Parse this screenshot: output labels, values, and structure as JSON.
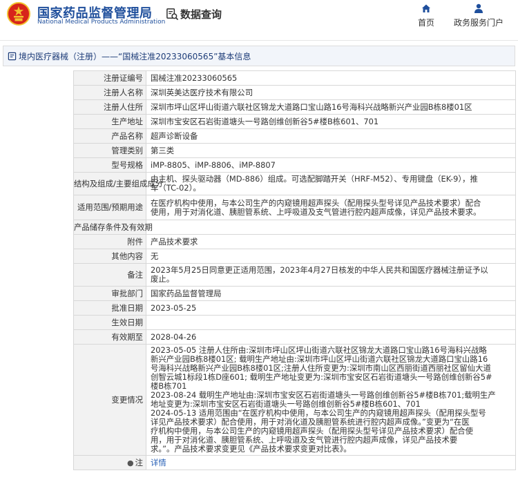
{
  "header": {
    "logo_cn": "国家药品监督管理局",
    "logo_en": "National Medical Products Administration",
    "data_query": "数据查询",
    "nav": [
      {
        "label": "首页",
        "icon": "home-icon"
      },
      {
        "label": "政务服务门户",
        "icon": "user-icon"
      }
    ]
  },
  "colors": {
    "brand_blue": "#1f4f9c",
    "link_blue": "#2a62b7",
    "emblem_red": "#d7251b",
    "emblem_gold": "#f2c12e"
  },
  "breadcrumb": "境内医疗器械（注册）——“国械注准20233060565”基本信息",
  "rows": [
    {
      "label": "注册证编号",
      "lines": [
        "国械注准20233060565"
      ]
    },
    {
      "label": "注册人名称",
      "lines": [
        "深圳英美达医疗技术有限公司"
      ]
    },
    {
      "label": "注册人住所",
      "lines": [
        "深圳市坪山区坪山街道六联社区锦龙大道路口宝山路16号海科兴战略新兴产业园B栋8楼01区"
      ]
    },
    {
      "label": "生产地址",
      "lines": [
        "深圳市宝安区石岩街道塘头一号路创维创新谷5#楼B栋601、701"
      ]
    },
    {
      "label": "产品名称",
      "lines": [
        "超声诊断设备"
      ]
    },
    {
      "label": "管理类别",
      "lines": [
        "第三类"
      ]
    },
    {
      "label": "型号规格",
      "lines": [
        "iMP-8805、iMP-8806、iMP-8807"
      ]
    },
    {
      "label": "结构及组成/主要组成成分",
      "lines": [
        "由主机、探头驱动器（MD-886）组成。可选配脚踏开关（HRF-M52）、专用键盘（EK-9），推",
        "车（TC-02）。"
      ]
    },
    {
      "label": "适用范围/预期用途",
      "lines": [
        "在医疗机构中使用，与本公司生产的内窥镜用超声探头（配用探头型号详见产品技术要求）配合",
        "使用，用于对消化道、胰胆管系统、上呼吸道及支气管进行腔内超声成像，详见产品技术要求。"
      ]
    },
    {
      "label": "产品储存条件及有效期",
      "lines": [
        ""
      ]
    },
    {
      "label": "附件",
      "lines": [
        "产品技术要求"
      ]
    },
    {
      "label": "其他内容",
      "lines": [
        "无"
      ]
    },
    {
      "label": "备注",
      "lines": [
        "2023年5月25日同意更正适用范围，2023年4月27日核发的中华人民共和国医疗器械注册证予以",
        "废止。"
      ]
    },
    {
      "label": "审批部门",
      "lines": [
        "国家药品监督管理局"
      ]
    },
    {
      "label": "批准日期",
      "lines": [
        "2023-05-25"
      ]
    },
    {
      "label": "生效日期",
      "lines": [
        ""
      ]
    },
    {
      "label": "有效期至",
      "lines": [
        "2028-04-26"
      ]
    },
    {
      "label": "变更情况",
      "lines": [
        "2023-05-05 注册人住所由:深圳市坪山区坪山街道六联社区锦龙大道路口宝山路16号海科兴战略",
        "新兴产业园B栋8楼01区; 载明生产地址由:深圳市坪山区坪山街道六联社区锦龙大道路口宝山路16",
        "号海科兴战略新兴产业园B栋8楼01区;注册人住所变更为:深圳市南山区西丽街道西丽社区留仙大道",
        "创智云城1标段1栋D座601; 载明生产地址变更为:深圳市宝安区石岩街道塘头一号路创维创新谷5#",
        "楼B栋701",
        "2023-08-24 载明生产地址由:深圳市宝安区石岩街道塘头一号路创维创新谷5#楼B栋701;载明生产",
        "地址变更为:深圳市宝安区石岩街道塘头一号路创维创新谷5#楼B栋601、701",
        "2024-05-13 适用范围由“在医疗机构中使用，与本公司生产的内窥镜用超声探头（配用探头型号",
        "详见产品技术要求）配合使用，用于对消化道及胰胆管系统进行腔内超声成像。”变更为“在医",
        "疗机构中使用，与本公司生产的内窥镜用超声探头（配用探头型号详见产品技术要求）配合使",
        "用，用于对消化道、胰胆管系统、上呼吸道及支气管进行腔内超声成像，详见产品技术要",
        "求。”。产品技术要求变更见《产品技术要求变更对比表》。"
      ]
    },
    {
      "label": "注",
      "lines": [
        "详情"
      ],
      "icon": "pin-icon"
    }
  ]
}
